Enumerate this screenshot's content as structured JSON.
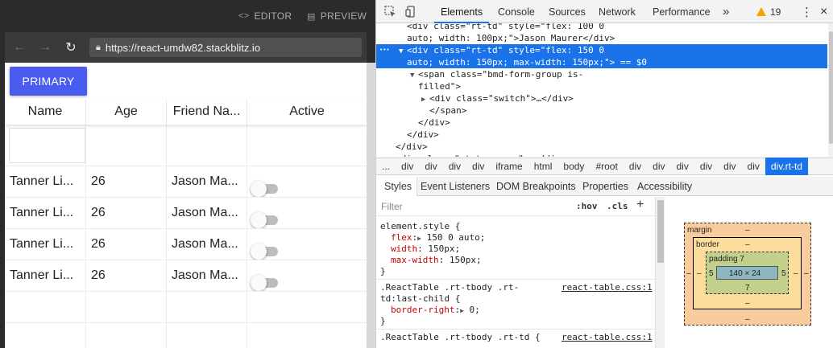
{
  "stackblitz": {
    "editor_label": "EDITOR",
    "preview_label": "PREVIEW",
    "url": "https://react-umdw82.stackblitz.io"
  },
  "preview": {
    "primary_button": "PRIMARY",
    "columns": [
      "Name",
      "Age",
      "Friend Na...",
      "Active"
    ],
    "rows": [
      {
        "name": "Tanner Li...",
        "age": "26",
        "friend": "Jason Ma..."
      },
      {
        "name": "Tanner Li...",
        "age": "26",
        "friend": "Jason Ma..."
      },
      {
        "name": "Tanner Li...",
        "age": "26",
        "friend": "Jason Ma..."
      },
      {
        "name": "Tanner Li...",
        "age": "26",
        "friend": "Jason Ma..."
      }
    ]
  },
  "devtools": {
    "tabs": [
      "Elements",
      "Console",
      "Sources",
      "Network",
      "Performance"
    ],
    "more_tabs": "»",
    "warnings_count": "19",
    "menu_dots": "⋮",
    "close": "×",
    "dom_lines": [
      {
        "indent": 38,
        "arrow": "",
        "html": "<div class=\"rt-td\" style=\"flex: 100 0"
      },
      {
        "indent": 38,
        "arrow": "",
        "html": "auto; width: 100px;\">Jason Maurer</div>"
      },
      {
        "indent": 38,
        "arrow": "▼",
        "html": "<div class=\"rt-td\" style=\"flex: 150 0",
        "selected": true
      },
      {
        "indent": 38,
        "arrow": "",
        "html": "auto; width: 150px; max-width: 150px;\"> == $0",
        "selected": true
      },
      {
        "indent": 52,
        "arrow": "▼",
        "html": "<span class=\"bmd-form-group is-"
      },
      {
        "indent": 52,
        "arrow": "",
        "html": "filled\">"
      },
      {
        "indent": 66,
        "arrow": "▶",
        "html": "<div class=\"switch\">…</div>"
      },
      {
        "indent": 66,
        "arrow": "",
        "html": "</span>"
      },
      {
        "indent": 52,
        "arrow": "",
        "html": "</div>"
      },
      {
        "indent": 38,
        "arrow": "",
        "html": "</div>"
      },
      {
        "indent": 24,
        "arrow": "",
        "html": "</div>"
      },
      {
        "indent": 24,
        "arrow": "▶",
        "html": "<div class=\"rt-tr-group\">…</div>"
      }
    ],
    "breadcrumbs": [
      "...",
      "div",
      "div",
      "div",
      "div",
      "iframe",
      "html",
      "body",
      "#root",
      "div",
      "div",
      "div",
      "div",
      "div",
      "div",
      "div.rt-td"
    ],
    "sub_tabs": [
      "Styles",
      "Event Listeners",
      "DOM Breakpoints",
      "Properties",
      "Accessibility"
    ],
    "styles": {
      "filter_placeholder": "Filter",
      "hov": ":hov",
      "cls": ".cls",
      "plus": "+",
      "rules": [
        {
          "selector": "element.style {",
          "source": "",
          "props": [
            {
              "name": "flex",
              "arrow": true,
              "value": "150 0 auto;"
            },
            {
              "name": "width",
              "arrow": false,
              "value": "150px;"
            },
            {
              "name": "max-width",
              "arrow": false,
              "value": "150px;"
            }
          ]
        },
        {
          "selector": ".ReactTable .rt-tbody .rt-",
          "selector2": "td:last-child {",
          "source": "react-table.css:1",
          "props": [
            {
              "name": "border-right",
              "arrow": true,
              "value": "0;"
            }
          ]
        },
        {
          "selector": ".ReactTable .rt-tbody .rt-td {",
          "source": "react-table.css:1",
          "props": []
        }
      ]
    },
    "box_model": {
      "margin_label": "margin",
      "margin_top": "–",
      "margin_bottom": "–",
      "margin_left": "–",
      "margin_right": "–",
      "border_label": "border",
      "border_top": "–",
      "border_bottom": "–",
      "border_left": "–",
      "border_right": "–",
      "padding_label": "padding 7",
      "padding_bottom": "7",
      "padding_left": "5",
      "padding_right": "5",
      "content": "140 × 24"
    }
  },
  "colors": {
    "primary_button": "#4a5cf0",
    "selected": "#1a73e8",
    "warning": "#f2a600"
  }
}
